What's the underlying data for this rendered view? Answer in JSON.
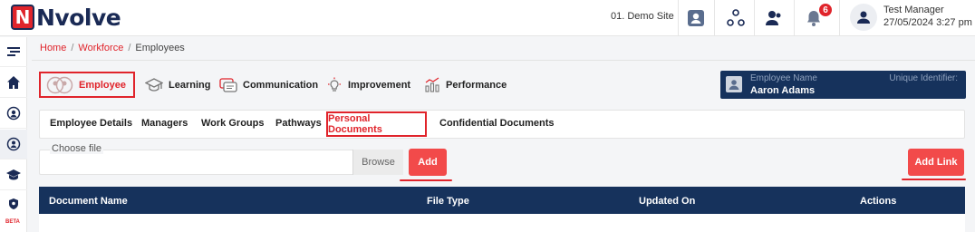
{
  "brand": {
    "logo_letter": "N",
    "logo_text": "Nvolve"
  },
  "header": {
    "site": "01. Demo Site",
    "notification_count": "6",
    "user_name": "Test Manager",
    "user_datetime": "27/05/2024 3:27 pm"
  },
  "sidebar": {
    "beta_label": "BETA"
  },
  "breadcrumb": {
    "home": "Home",
    "workforce": "Workforce",
    "current": "Employees",
    "separator": "/"
  },
  "module_tabs": [
    {
      "label": "Employee",
      "icon": "employee-icon",
      "active": true
    },
    {
      "label": "Learning",
      "icon": "graduation-cap-icon"
    },
    {
      "label": "Communication",
      "icon": "chat-icon"
    },
    {
      "label": "Improvement",
      "icon": "lightbulb-icon"
    },
    {
      "label": "Performance",
      "icon": "chart-icon"
    }
  ],
  "employee_card": {
    "label": "Employee Name",
    "name": "Aaron Adams",
    "uid_label": "Unique Identifier:"
  },
  "sub_tabs": [
    {
      "label": "Employee Details"
    },
    {
      "label": "Managers"
    },
    {
      "label": "Work Groups"
    },
    {
      "label": "Pathways"
    },
    {
      "label": "Personal Documents",
      "active": true
    },
    {
      "label": "Confidential Documents"
    }
  ],
  "upload": {
    "label": "Choose file",
    "browse": "Browse",
    "add": "Add",
    "add_link": "Add Link"
  },
  "table": {
    "columns": [
      "Document Name",
      "File Type",
      "Updated On",
      "Actions"
    ]
  },
  "colors": {
    "accent": "#e0242b",
    "navy": "#16325c",
    "button": "#f24a4a"
  }
}
